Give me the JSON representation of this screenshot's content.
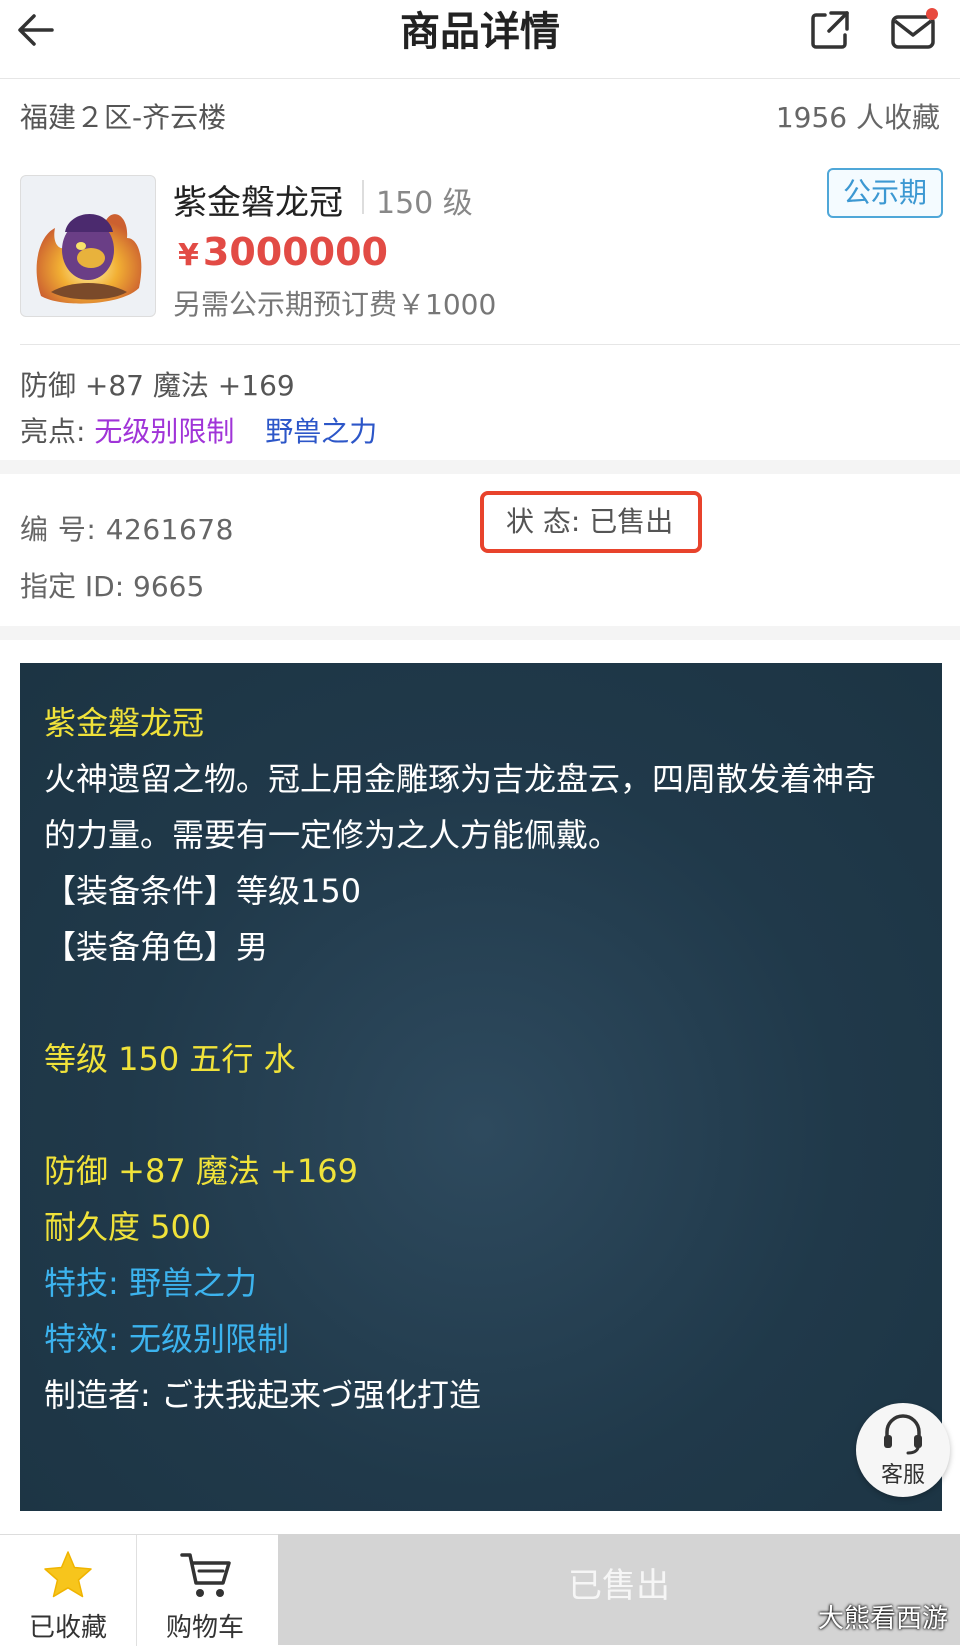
{
  "header": {
    "title": "商品详情"
  },
  "listing": {
    "server": "福建２区-齐云楼",
    "favorites": "1956 人收藏",
    "name": "紫金磐龙冠",
    "level": "150 级",
    "badge": "公示期",
    "currency": "¥",
    "price": "3000000",
    "fee": "另需公示期预订费￥1000",
    "stats": "防御 +87 魔法 +169",
    "highlight_label": "亮点:",
    "highlight_1": "无级别限制",
    "highlight_2": "野兽之力",
    "serial": "编 号:  4261678",
    "status": "状 态:  已售出",
    "designated_id": "指定 ID:  9665"
  },
  "description": {
    "name": "紫金磐龙冠",
    "text_1": "火神遗留之物。冠上用金雕琢为吉龙盘云，四周散发着神奇",
    "text_2": "的力量。需要有一定修为之人方能佩戴。",
    "req_level": "【装备条件】等级150",
    "req_role": "【装备角色】男",
    "level_element": "等级 150 五行 水",
    "stats": "防御 +87 魔法 +169",
    "durability": "耐久度 500",
    "skill": "特技:  野兽之力",
    "effect": "特效:  无级别限制",
    "maker": "制造者:  ご扶我起来づ强化打造"
  },
  "service": {
    "label": "客服"
  },
  "bottom_bar": {
    "favorite_label": "已收藏",
    "cart_label": "购物车",
    "sold_label": "已售出"
  },
  "watermark": "大熊看西游",
  "colors": {
    "price": "#e24b45",
    "badge": "#3c98d2",
    "highlight_purple": "#a034d8",
    "highlight_blue": "#2c56c8",
    "status_frame": "#e8432c",
    "panel_bg": "#20394a",
    "desc_yellow": "#f0e23a",
    "desc_blue": "#3cb3ee",
    "star": "#f7c51c"
  }
}
